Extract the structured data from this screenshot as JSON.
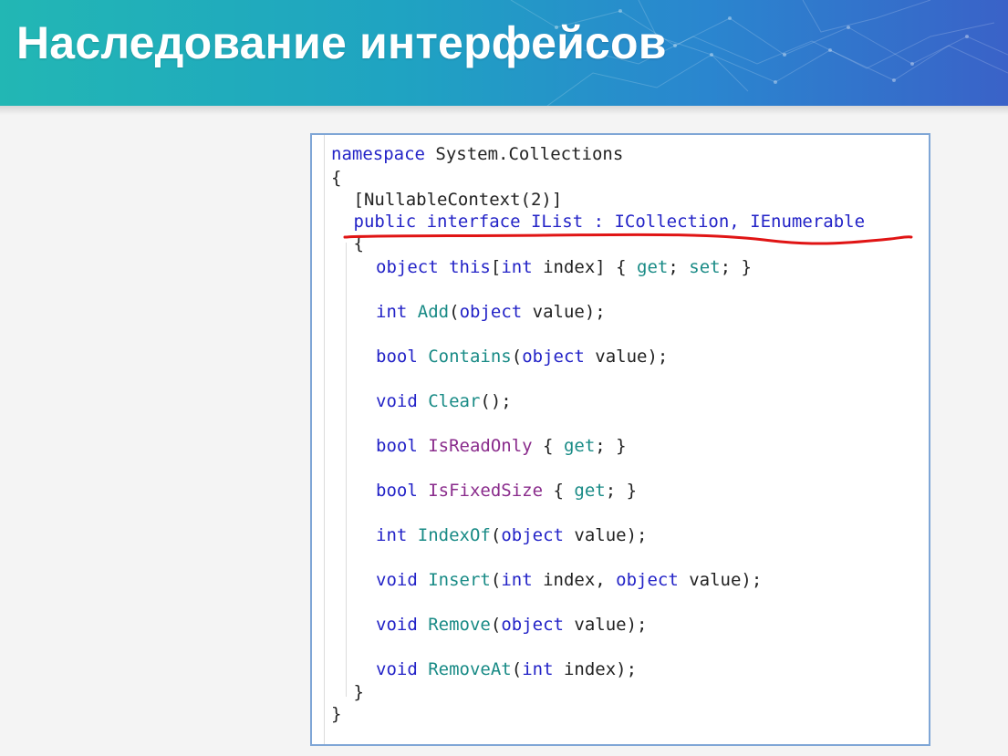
{
  "slide": {
    "title": "Наследование интерфейсов",
    "colors": {
      "banner_start": "#22b7b4",
      "banner_end": "#3a62c8",
      "underline": "#e01414",
      "keyword": "#2323c7",
      "method": "#198b86",
      "property": "#8a2c8c"
    }
  },
  "code": {
    "lines": [
      {
        "indent": 0,
        "tokens": [
          {
            "t": "namespace",
            "c": "kw"
          },
          {
            "t": " System.Collections",
            "c": "pl"
          }
        ]
      },
      {
        "indent": 0,
        "tokens": [
          {
            "t": "{",
            "c": "pl"
          }
        ]
      },
      {
        "indent": 1,
        "tokens": [
          {
            "t": "[NullableContext(2)]",
            "c": "pl"
          }
        ]
      },
      {
        "indent": 1,
        "tokens": [
          {
            "t": "public interface IList : ICollection, IEnumerable",
            "c": "kw"
          }
        ]
      },
      {
        "indent": 1,
        "tokens": [
          {
            "t": "{",
            "c": "pl"
          }
        ]
      },
      {
        "indent": 2,
        "tokens": [
          {
            "t": "object",
            "c": "kw"
          },
          {
            "t": " ",
            "c": "pl"
          },
          {
            "t": "this",
            "c": "kw"
          },
          {
            "t": "[",
            "c": "pl"
          },
          {
            "t": "int",
            "c": "kw"
          },
          {
            "t": " index] { ",
            "c": "pl"
          },
          {
            "t": "get",
            "c": "acc"
          },
          {
            "t": "; ",
            "c": "pl"
          },
          {
            "t": "set",
            "c": "acc"
          },
          {
            "t": "; }",
            "c": "pl"
          }
        ]
      },
      {
        "indent": 2,
        "tokens": [
          {
            "t": "int",
            "c": "kw"
          },
          {
            "t": " ",
            "c": "pl"
          },
          {
            "t": "Add",
            "c": "fn"
          },
          {
            "t": "(",
            "c": "pl"
          },
          {
            "t": "object",
            "c": "kw"
          },
          {
            "t": " value);",
            "c": "pl"
          }
        ]
      },
      {
        "indent": 2,
        "tokens": [
          {
            "t": "bool",
            "c": "kw"
          },
          {
            "t": " ",
            "c": "pl"
          },
          {
            "t": "Contains",
            "c": "fn"
          },
          {
            "t": "(",
            "c": "pl"
          },
          {
            "t": "object",
            "c": "kw"
          },
          {
            "t": " value);",
            "c": "pl"
          }
        ]
      },
      {
        "indent": 2,
        "tokens": [
          {
            "t": "void",
            "c": "kw"
          },
          {
            "t": " ",
            "c": "pl"
          },
          {
            "t": "Clear",
            "c": "fn"
          },
          {
            "t": "();",
            "c": "pl"
          }
        ]
      },
      {
        "indent": 2,
        "tokens": [
          {
            "t": "bool",
            "c": "kw"
          },
          {
            "t": " ",
            "c": "pl"
          },
          {
            "t": "IsReadOnly",
            "c": "prop"
          },
          {
            "t": " { ",
            "c": "pl"
          },
          {
            "t": "get",
            "c": "acc"
          },
          {
            "t": "; }",
            "c": "pl"
          }
        ]
      },
      {
        "indent": 2,
        "tokens": [
          {
            "t": "bool",
            "c": "kw"
          },
          {
            "t": " ",
            "c": "pl"
          },
          {
            "t": "IsFixedSize",
            "c": "prop"
          },
          {
            "t": " { ",
            "c": "pl"
          },
          {
            "t": "get",
            "c": "acc"
          },
          {
            "t": "; }",
            "c": "pl"
          }
        ]
      },
      {
        "indent": 2,
        "tokens": [
          {
            "t": "int",
            "c": "kw"
          },
          {
            "t": " ",
            "c": "pl"
          },
          {
            "t": "IndexOf",
            "c": "fn"
          },
          {
            "t": "(",
            "c": "pl"
          },
          {
            "t": "object",
            "c": "kw"
          },
          {
            "t": " value);",
            "c": "pl"
          }
        ]
      },
      {
        "indent": 2,
        "tokens": [
          {
            "t": "void",
            "c": "kw"
          },
          {
            "t": " ",
            "c": "pl"
          },
          {
            "t": "Insert",
            "c": "fn"
          },
          {
            "t": "(",
            "c": "pl"
          },
          {
            "t": "int",
            "c": "kw"
          },
          {
            "t": " index, ",
            "c": "pl"
          },
          {
            "t": "object",
            "c": "kw"
          },
          {
            "t": " value);",
            "c": "pl"
          }
        ]
      },
      {
        "indent": 2,
        "tokens": [
          {
            "t": "void",
            "c": "kw"
          },
          {
            "t": " ",
            "c": "pl"
          },
          {
            "t": "Remove",
            "c": "fn"
          },
          {
            "t": "(",
            "c": "pl"
          },
          {
            "t": "object",
            "c": "kw"
          },
          {
            "t": " value);",
            "c": "pl"
          }
        ]
      },
      {
        "indent": 2,
        "tokens": [
          {
            "t": "void",
            "c": "kw"
          },
          {
            "t": " ",
            "c": "pl"
          },
          {
            "t": "RemoveAt",
            "c": "fn"
          },
          {
            "t": "(",
            "c": "pl"
          },
          {
            "t": "int",
            "c": "kw"
          },
          {
            "t": " index);",
            "c": "pl"
          }
        ]
      },
      {
        "indent": 1,
        "tokens": [
          {
            "t": "}",
            "c": "pl"
          }
        ]
      },
      {
        "indent": 0,
        "tokens": [
          {
            "t": "}",
            "c": "pl"
          }
        ]
      }
    ]
  }
}
